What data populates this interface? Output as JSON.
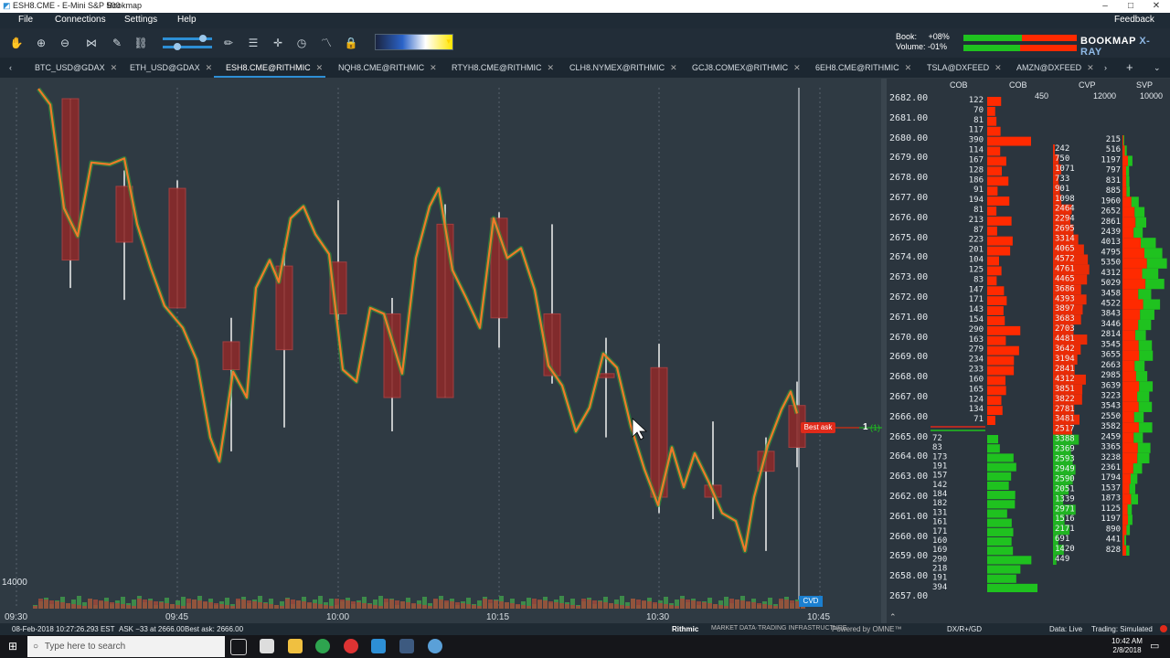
{
  "window": {
    "title": "ESH8.CME - E-Mini S&P 500",
    "app": "Bookmap",
    "controls": [
      "–",
      "□",
      "✕"
    ]
  },
  "menu": [
    "File",
    "Connections",
    "Settings",
    "Help"
  ],
  "feedback": "Feedback",
  "toolbar": {
    "icons": [
      "hand-icon",
      "zoom-in-icon",
      "zoom-out-icon",
      "share-icon",
      "pin-icon",
      "link-icon",
      "pencil-icon",
      "chat-icon",
      "crosshair-icon",
      "timer-icon",
      "signal-icon",
      "lock-icon"
    ],
    "book_label": "Book:",
    "book_value": "+08%",
    "volume_label": "Volume:",
    "volume_value": "-01%",
    "brand": "BOOKMAP",
    "brand_suffix": "X-RAY",
    "heatmap_caret": "▾"
  },
  "tabs": [
    {
      "label": "BTC_USD@GDAX",
      "active": false
    },
    {
      "label": "ETH_USD@GDAX",
      "active": false
    },
    {
      "label": "ESH8.CME@RITHMIC",
      "active": true
    },
    {
      "label": "NQH8.CME@RITHMIC",
      "active": false
    },
    {
      "label": "RTYH8.CME@RITHMIC",
      "active": false
    },
    {
      "label": "CLH8.NYMEX@RITHMIC",
      "active": false
    },
    {
      "label": "GCJ8.COMEX@RITHMIC",
      "active": false
    },
    {
      "label": "6EH8.CME@RITHMIC",
      "active": false
    },
    {
      "label": "TSLA@DXFEED",
      "active": false
    },
    {
      "label": "AMZN@DXFEED",
      "active": false
    }
  ],
  "tab_close": "✕",
  "tab_nav": {
    "left": "‹",
    "right": "›",
    "add": "+",
    "menu": "⌄"
  },
  "panel_headers": {
    "cob1": "COB",
    "cob2": "COB",
    "cvp": "CVP",
    "svp": "SVP",
    "cob_max": "450",
    "cvp_max": "12000",
    "svp_max": "10000"
  },
  "price_axis": [
    "2682.00",
    "2681.00",
    "2680.00",
    "2679.00",
    "2678.00",
    "2677.00",
    "2676.00",
    "2675.00",
    "2674.00",
    "2673.00",
    "2672.00",
    "2671.00",
    "2670.00",
    "2669.00",
    "2668.00",
    "2667.00",
    "2666.00",
    "2665.00",
    "2664.00",
    "2663.00",
    "2662.00",
    "2661.00",
    "2660.00",
    "2659.00",
    "2658.00",
    "2657.00"
  ],
  "ask_sizes": [
    "122",
    "70",
    "81",
    "117",
    "390",
    "114",
    "167",
    "128",
    "186",
    "91",
    "194",
    "81",
    "213",
    "87",
    "223",
    "201",
    "104",
    "125",
    "83",
    "147",
    "171",
    "143",
    "154",
    "290",
    "163",
    "279",
    "234",
    "233",
    "160",
    "165",
    "124",
    "134",
    "71"
  ],
  "bid_sizes": [
    "72",
    "83",
    "173",
    "191",
    "157",
    "142",
    "184",
    "182",
    "131",
    "161",
    "171",
    "160",
    "169",
    "290",
    "218",
    "191",
    "394"
  ],
  "cvp_values": [
    "242",
    "750",
    "1071",
    "733",
    "901",
    "1098",
    "2464",
    "2294",
    "2695",
    "3314",
    "4065",
    "4572",
    "4761",
    "4465",
    "3686",
    "4393",
    "3897",
    "3683",
    "2703",
    "4481",
    "3642",
    "3194",
    "2841",
    "4312",
    "3851",
    "3822",
    "2781",
    "3481",
    "2517",
    "3388",
    "2369",
    "2593",
    "2949",
    "2590",
    "2051",
    "1339",
    "2971",
    "1516",
    "2171",
    "691",
    "1420",
    "449"
  ],
  "svp_values": [
    "215",
    "516",
    "1197",
    "797",
    "831",
    "885",
    "1960",
    "2652",
    "2861",
    "2439",
    "4013",
    "4795",
    "5350",
    "4312",
    "5029",
    "3458",
    "4522",
    "3843",
    "3446",
    "2814",
    "3545",
    "3655",
    "2663",
    "2985",
    "3639",
    "3223",
    "3543",
    "2550",
    "3582",
    "2459",
    "3365",
    "3238",
    "2361",
    "1794",
    "1537",
    "1873",
    "1125",
    "1197",
    "890",
    "441",
    "828"
  ],
  "volume_axis_label": "14000",
  "time_labels": [
    "09:30",
    "09:45",
    "10:00",
    "10:15",
    "10:30",
    "10:45"
  ],
  "best_ask": {
    "label": "Best ask",
    "order": "1",
    "order_paren": "(1)"
  },
  "cvd_label": "CVD",
  "status": {
    "timestamp": "08-Feb-2018 10:27:26.293 EST",
    "ask_info": "ASK −33 at 2666.00",
    "best_ask_info": "Best ask: 2666.00",
    "rithmic": "Rithmic",
    "rithmic_tag": "MARKET DATA·TRADING INFRASTRUCTURE",
    "omne": "Powered by OMNE™",
    "mode": "DX/R+/GD",
    "data": "Data: Live",
    "trading": "Trading: Simulated"
  },
  "taskbar": {
    "search_placeholder": "Type here to search",
    "time": "10:42 AM",
    "date": "2/8/2018"
  },
  "colors": {
    "bid": "#1fc21f",
    "ask": "#ff2a00",
    "bg": "#2f3a43",
    "accent": "#2d8fd5",
    "candle_up": "#2e9c3a",
    "candle_down": "#8a2a2a"
  }
}
